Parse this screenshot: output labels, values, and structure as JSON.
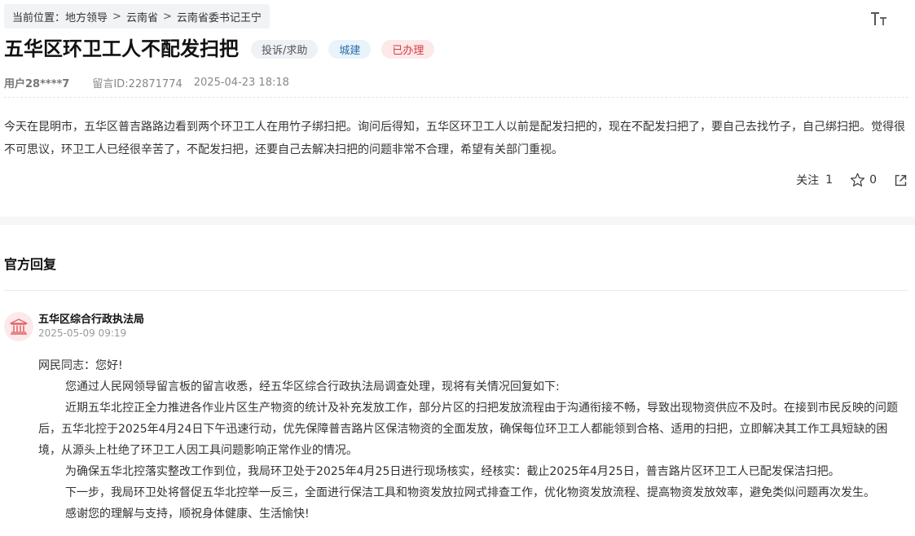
{
  "breadcrumb": {
    "prefix": "当前位置：",
    "items": [
      "地方领导",
      "云南省",
      "云南省委书记王宁"
    ],
    "separator": ">"
  },
  "header": {
    "font_size_icon": "font-size-icon",
    "title": "五华区环卫工人不配发扫把",
    "tags": {
      "category": "投诉/求助",
      "field": "城建",
      "status": "已办理"
    }
  },
  "meta": {
    "user": "用户28****7",
    "message_id": "留言ID:22871774",
    "time": "2025-04-23 18:18"
  },
  "content": "今天在昆明市，五华区普吉路路边看到两个环卫工人在用竹子绑扫把。询问后得知，五华区环卫工人以前是配发扫把的，现在不配发扫把了，要自己去找竹子，自己绑扫把。觉得很不可思议，环卫工人已经很辛苦了，不配发扫把，还要自己去解决扫把的问题非常不合理，希望有关部门重视。",
  "actions": {
    "follow_label": "关注",
    "follow_count": "1",
    "favorite_count": "0"
  },
  "reply": {
    "section_title": "官方回复",
    "department": "五华区综合行政执法局",
    "time": "2025-05-09 09:19",
    "greeting": "网民同志：您好!",
    "paragraphs": [
      "您通过人民网领导留言板的留言收悉，经五华区综合行政执法局调查处理，现将有关情况回复如下:",
      "近期五华北控正全力推进各作业片区生产物资的统计及补充发放工作，部分片区的扫把发放流程由于沟通衔接不畅，导致出现物资供应不及时。在接到市民反映的问题后，五华北控于2025年4月24日下午迅速行动，优先保障普吉路片区保洁物资的全面发放，确保每位环卫工人都能领到合格、适用的扫把，立即解决其工作工具短缺的困境，从源头上杜绝了环卫工人因工具问题影响正常作业的情况。",
      "为确保五华北控落实整改工作到位，我局环卫处于2025年4月25日进行现场核实，经核实：截止2025年4月25日，普吉路片区环卫工人已配发保洁扫把。",
      "下一步，我局环卫处将督促五华北控举一反三，全面进行保洁工具和物资发放拉网式排查工作，优化物资发放流程、提高物资发放效率，避免类似问题再次发生。",
      "感谢您的理解与支持，顺祝身体健康、生活愉快!"
    ]
  },
  "colors": {
    "status_red": "#d33a3f",
    "field_blue": "#2b6fad",
    "icon_red": "#e0666b"
  }
}
